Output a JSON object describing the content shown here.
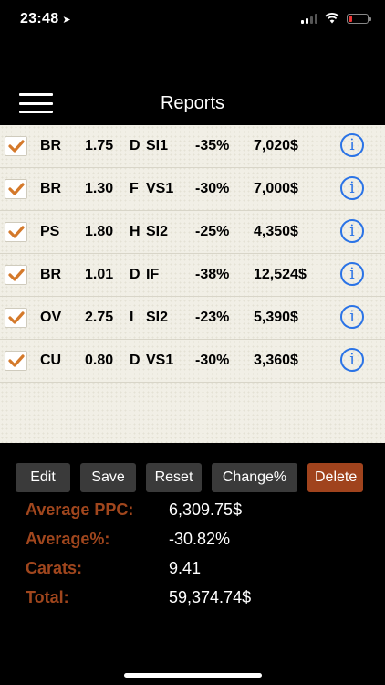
{
  "status_bar": {
    "time": "23:48",
    "location_icon": "location-arrow-icon",
    "battery_color": "#e33333"
  },
  "header": {
    "title": "Reports",
    "menu_icon": "hamburger-menu-icon"
  },
  "reports": [
    {
      "checked": true,
      "type": "BR",
      "carat": "1.75",
      "color": "D",
      "clarity": "SI1",
      "percent": "-35%",
      "price": "7,020$"
    },
    {
      "checked": true,
      "type": "BR",
      "carat": "1.30",
      "color": "F",
      "clarity": "VS1",
      "percent": "-30%",
      "price": "7,000$"
    },
    {
      "checked": true,
      "type": "PS",
      "carat": "1.80",
      "color": "H",
      "clarity": "SI2",
      "percent": "-25%",
      "price": "4,350$"
    },
    {
      "checked": true,
      "type": "BR",
      "carat": "1.01",
      "color": "D",
      "clarity": "IF",
      "percent": "-38%",
      "price": "12,524$"
    },
    {
      "checked": true,
      "type": "OV",
      "carat": "2.75",
      "color": "I",
      "clarity": "SI2",
      "percent": "-23%",
      "price": "5,390$"
    },
    {
      "checked": true,
      "type": "CU",
      "carat": "0.80",
      "color": "D",
      "clarity": "VS1",
      "percent": "-30%",
      "price": "3,360$"
    }
  ],
  "info_icon_label": "i",
  "toolbar": {
    "edit_label": "Edit",
    "save_label": "Save",
    "reset_label": "Reset",
    "change_label": "Change%",
    "delete_label": "Delete"
  },
  "stats": {
    "avg_ppc_label": "Average PPC:",
    "avg_ppc_value": "6,309.75$",
    "avg_pct_label": "Average%:",
    "avg_pct_value": "-30.82%",
    "carats_label": "Carats:",
    "carats_value": "9.41",
    "total_label": "Total:",
    "total_value": "59,374.74$"
  },
  "colors": {
    "accent": "#a0461d",
    "delete_button": "#a0431d",
    "info": "#2a73e6",
    "check": "#d4792a",
    "list_bg": "#f1efe6"
  }
}
